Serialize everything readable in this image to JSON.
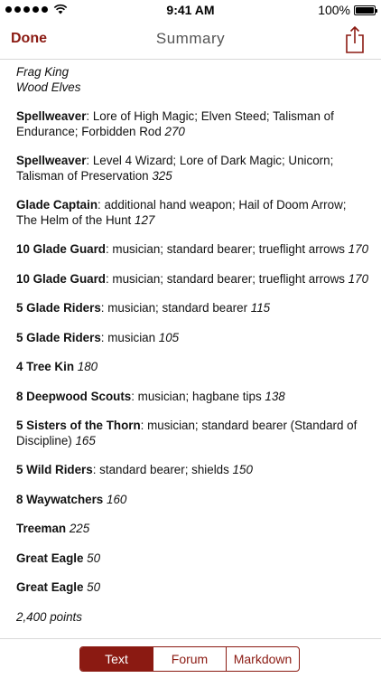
{
  "status_bar": {
    "time": "9:41 AM",
    "battery": "100%"
  },
  "nav": {
    "done_label": "Done",
    "title": "Summary",
    "share_icon": "share-icon"
  },
  "list": {
    "name": "Frag King",
    "faction": "Wood Elves"
  },
  "entries": [
    {
      "name": "Spellweaver",
      "details": ": Lore of High Magic; Elven Steed; Talisman of Endurance; Forbidden Rod ",
      "points": "270"
    },
    {
      "name": "Spellweaver",
      "details": ": Level 4 Wizard; Lore of Dark Magic; Unicorn; Talisman of Preservation ",
      "points": "325"
    },
    {
      "name": "Glade Captain",
      "details": ": additional hand weapon; Hail of Doom Arrow; The Helm of the Hunt ",
      "points": "127"
    },
    {
      "name": "10 Glade Guard",
      "details": ": musician; standard bearer; trueflight arrows ",
      "points": "170"
    },
    {
      "name": "10 Glade Guard",
      "details": ": musician; standard bearer; trueflight arrows ",
      "points": "170"
    },
    {
      "name": "5 Glade Riders",
      "details": ": musician; standard bearer ",
      "points": "115"
    },
    {
      "name": "5 Glade Riders",
      "details": ": musician ",
      "points": "105"
    },
    {
      "name": "4 Tree Kin",
      "details": " ",
      "points": "180"
    },
    {
      "name": "8 Deepwood Scouts",
      "details": ": musician; hagbane tips ",
      "points": "138"
    },
    {
      "name": "5 Sisters of the Thorn",
      "details": ": musician; standard bearer (Standard of Discipline) ",
      "points": "165"
    },
    {
      "name": "5 Wild Riders",
      "details": ": standard bearer; shields ",
      "points": "150"
    },
    {
      "name": "8 Waywatchers",
      "details": " ",
      "points": "160"
    },
    {
      "name": "Treeman",
      "details": " ",
      "points": "225"
    },
    {
      "name": "Great Eagle",
      "details": " ",
      "points": "50"
    },
    {
      "name": "Great Eagle",
      "details": " ",
      "points": "50"
    }
  ],
  "total": "2,400 points",
  "tabs": [
    {
      "label": "Text",
      "active": true
    },
    {
      "label": "Forum",
      "active": false
    },
    {
      "label": "Markdown",
      "active": false
    }
  ],
  "colors": {
    "accent": "#8b1a12"
  }
}
